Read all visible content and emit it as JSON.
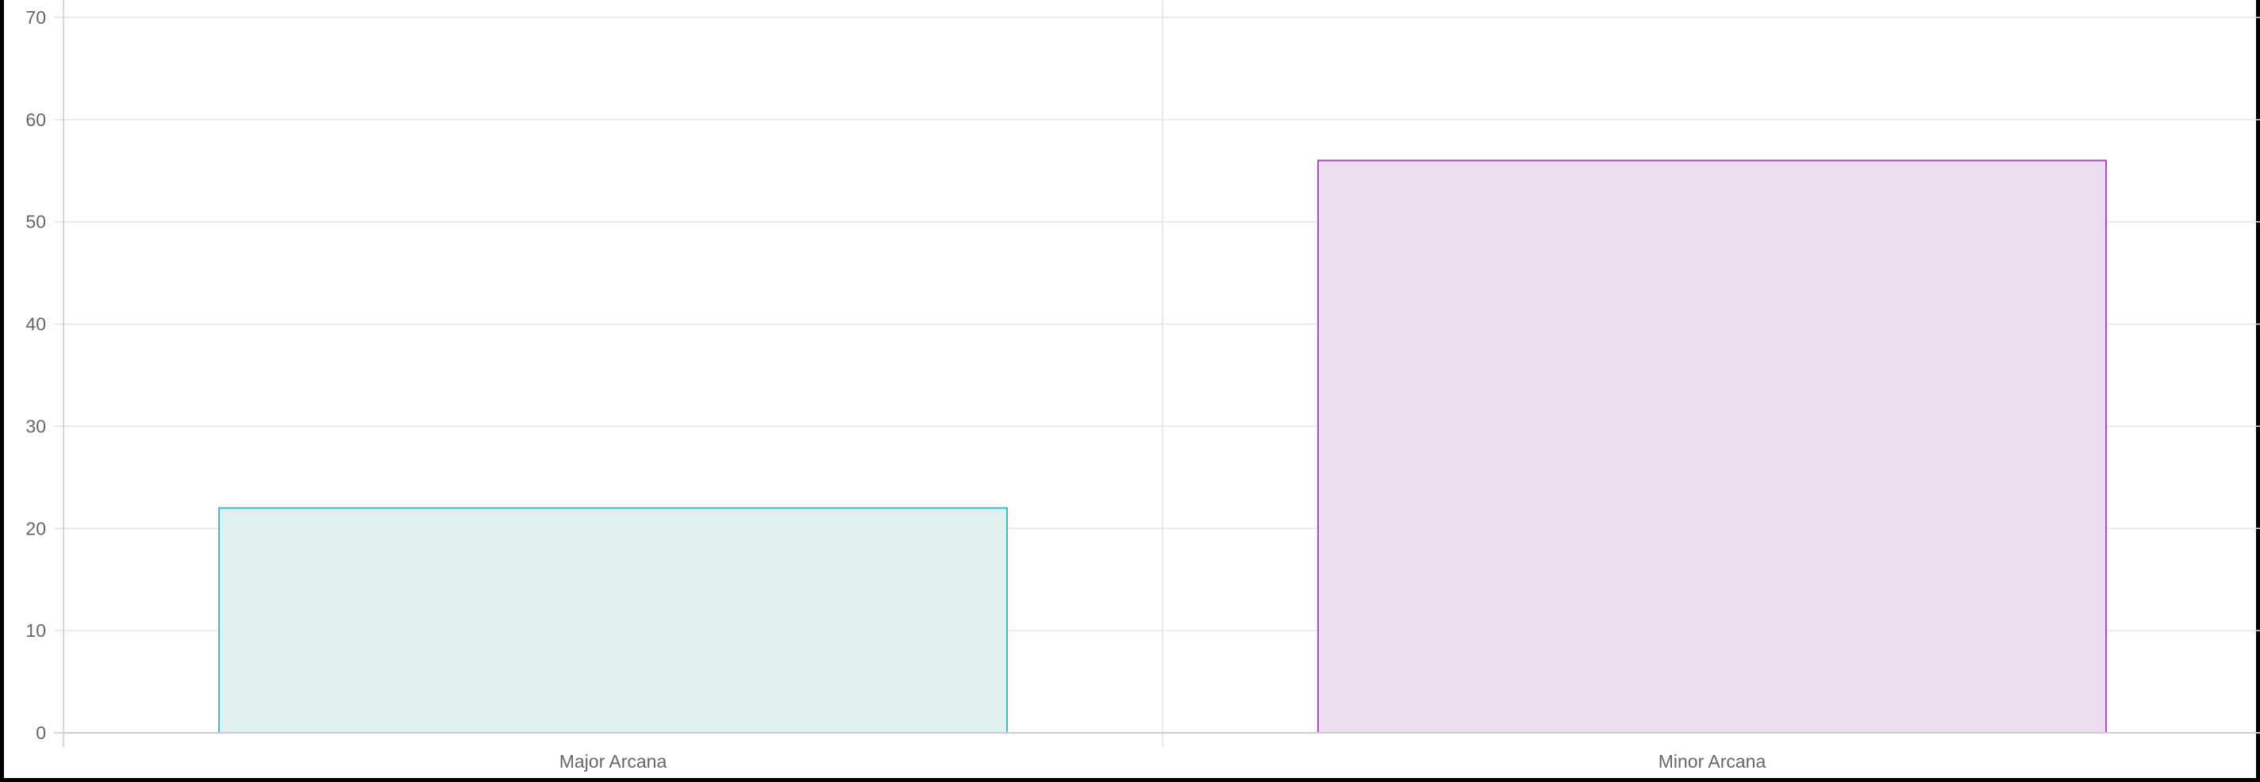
{
  "chart_data": {
    "type": "bar",
    "categories": [
      "Major Arcana",
      "Minor Arcana"
    ],
    "values": [
      22,
      56
    ],
    "ylim": [
      0,
      70
    ],
    "yticks": [
      0,
      10,
      20,
      30,
      40,
      50,
      60,
      70
    ],
    "grid": true,
    "colors": {
      "fills": [
        "#dff0f0",
        "#eddcf0"
      ],
      "borders": [
        "#4bb5c0",
        "#a94cc2"
      ],
      "grid": "#e4e4e4",
      "axis": "#cccccc",
      "tick_text": "#666666"
    }
  }
}
